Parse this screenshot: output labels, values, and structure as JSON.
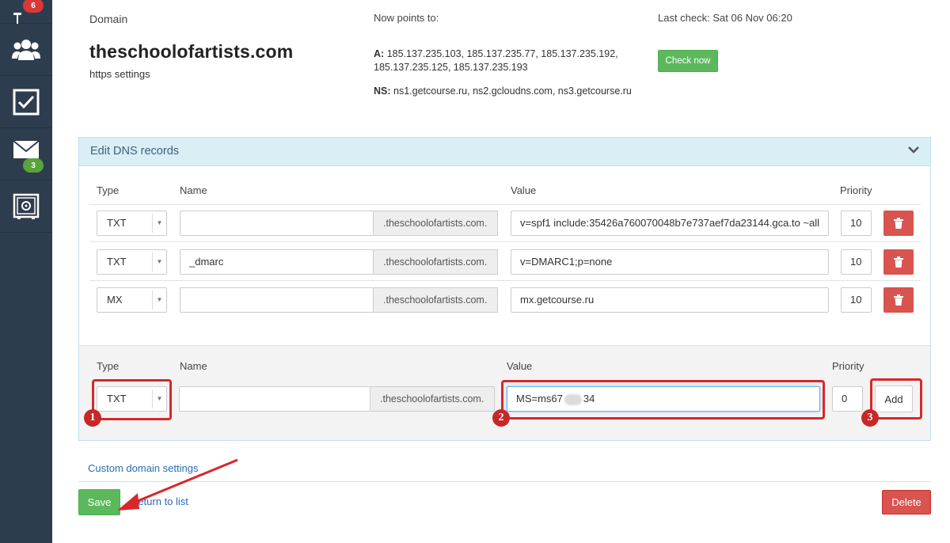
{
  "sidebar": {
    "items": [
      {
        "icon": "pin-icon",
        "badge": "6"
      },
      {
        "icon": "users-icon"
      },
      {
        "icon": "checkbox-icon"
      },
      {
        "icon": "mail-icon",
        "badge": "3"
      },
      {
        "icon": "safe-icon"
      }
    ]
  },
  "domain": {
    "label": "Domain",
    "name": "theschoolofartists.com",
    "https_link": "https settings",
    "points_label": "Now points to:",
    "a_key": "A:",
    "a_line1": "185.137.235.103, 185.137.235.77, 185.137.235.192,",
    "a_line2": "185.137.235.125, 185.137.235.193",
    "ns_key": "NS:",
    "ns_value": "ns1.getcourse.ru, ns2.gcloudns.com, ns3.getcourse.ru",
    "last_check": "Last check: Sat 06 Nov 06:20",
    "check_now": "Check now"
  },
  "dns_panel": {
    "title": "Edit DNS records",
    "columns": {
      "type": "Type",
      "name": "Name",
      "value": "Value",
      "priority": "Priority"
    },
    "records": [
      {
        "type": "TXT",
        "name": "",
        "suffix": ".theschoolofartists.com.",
        "value": "v=spf1 include:35426a760070048b7e737aef7da23144.gca.to ~all",
        "priority": "10"
      },
      {
        "type": "TXT",
        "name": "_dmarc",
        "suffix": ".theschoolofartists.com.",
        "value": "v=DMARC1;p=none",
        "priority": "10"
      },
      {
        "type": "MX",
        "name": "",
        "suffix": ".theschoolofartists.com.",
        "value": "mx.getcourse.ru",
        "priority": "10"
      }
    ],
    "new_record": {
      "type": "TXT",
      "name": "",
      "suffix": ".theschoolofartists.com.",
      "value": "MS=ms67",
      "value_tail": "34",
      "priority": "0",
      "add_label": "Add"
    }
  },
  "annotations": {
    "step1": "1",
    "step2": "2",
    "step3": "3"
  },
  "footer": {
    "custom_settings": "Custom domain settings",
    "save": "Save",
    "return": "return to list",
    "delete": "Delete"
  },
  "colors": {
    "sidebar": "#2e3d4e",
    "save": "#5cb85c",
    "danger": "#d9534f",
    "highlight": "#d7282b"
  }
}
